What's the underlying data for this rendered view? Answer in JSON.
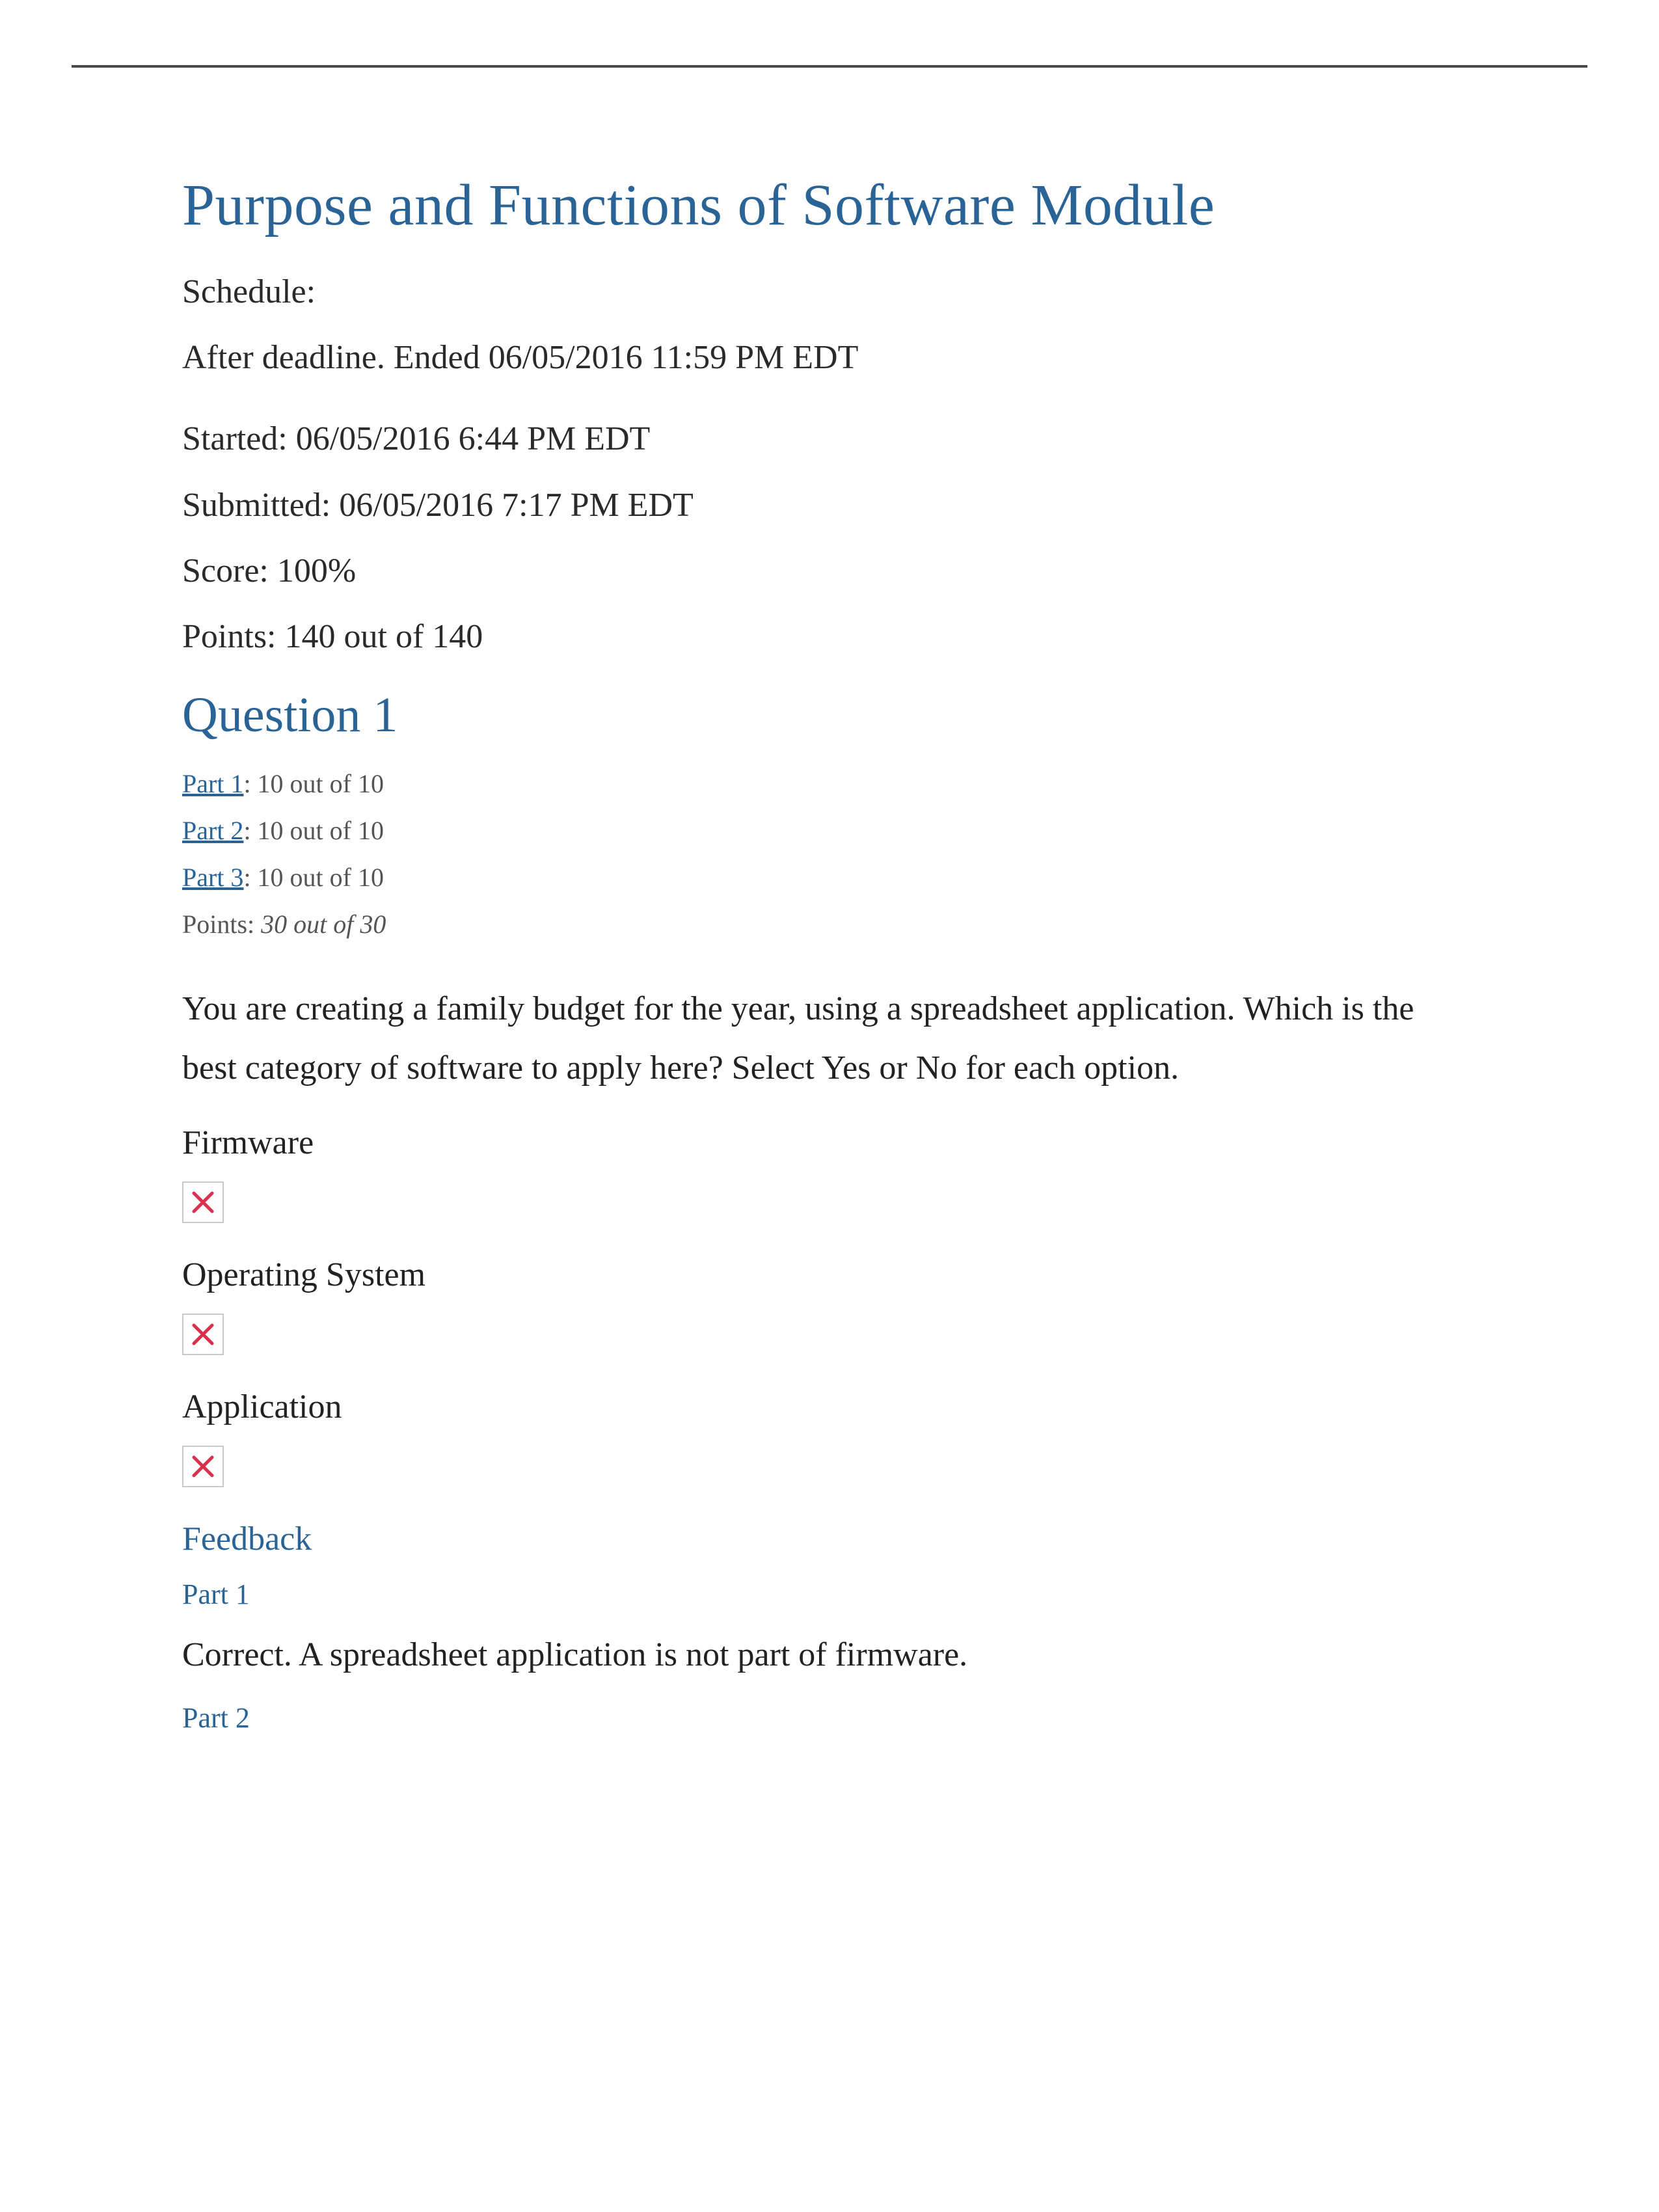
{
  "module": {
    "title": "Purpose and Functions of Software Module"
  },
  "meta": {
    "schedule_label": "Schedule:",
    "schedule_value": "After deadline. Ended 06/05/2016 11:59 PM EDT",
    "started": "Started: 06/05/2016 6:44 PM EDT",
    "submitted": "Submitted: 06/05/2016 7:17 PM EDT",
    "score": "Score: 100%",
    "points": "Points: 140 out of 140"
  },
  "question": {
    "heading": "Question 1",
    "parts": [
      {
        "link": "Part 1",
        "score": ": 10 out of 10"
      },
      {
        "link": "Part 2",
        "score": ": 10 out of 10"
      },
      {
        "link": "Part 3",
        "score": ": 10 out of 10"
      }
    ],
    "points_label": "Points: ",
    "points_value": "30 out of 30",
    "text": "You are creating a family budget for the year, using a spreadsheet application. Which is the best category of software to apply here? Select Yes or No for each option.",
    "options": [
      {
        "label": "Firmware"
      },
      {
        "label": "Operating System"
      },
      {
        "label": "Application"
      }
    ]
  },
  "feedback": {
    "heading": "Feedback",
    "parts": [
      {
        "heading": "Part 1",
        "text": "Correct. A spreadsheet application is not part of firmware."
      },
      {
        "heading": "Part 2",
        "text": ""
      }
    ]
  }
}
